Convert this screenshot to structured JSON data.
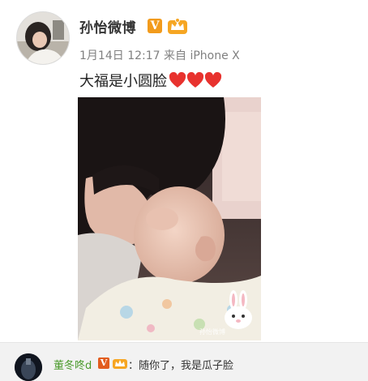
{
  "post": {
    "username": "孙怡微博",
    "verified_badge": "V",
    "member_badge": "crown-icon",
    "date": "1月14日",
    "time": "12:17",
    "source_prefix": "来自",
    "source_device": "iPhone X",
    "text": "大福是小圆脸",
    "hearts_count": 3,
    "photo_watermark": "孙怡微博"
  },
  "comment": {
    "author": "董冬咚d",
    "verified_badge": "V",
    "separator": "：",
    "text": "随你了，我是瓜子脸"
  },
  "colors": {
    "verified": "#f29b1c",
    "comment_name": "#4a9a2b",
    "heart": "#e8322e"
  }
}
